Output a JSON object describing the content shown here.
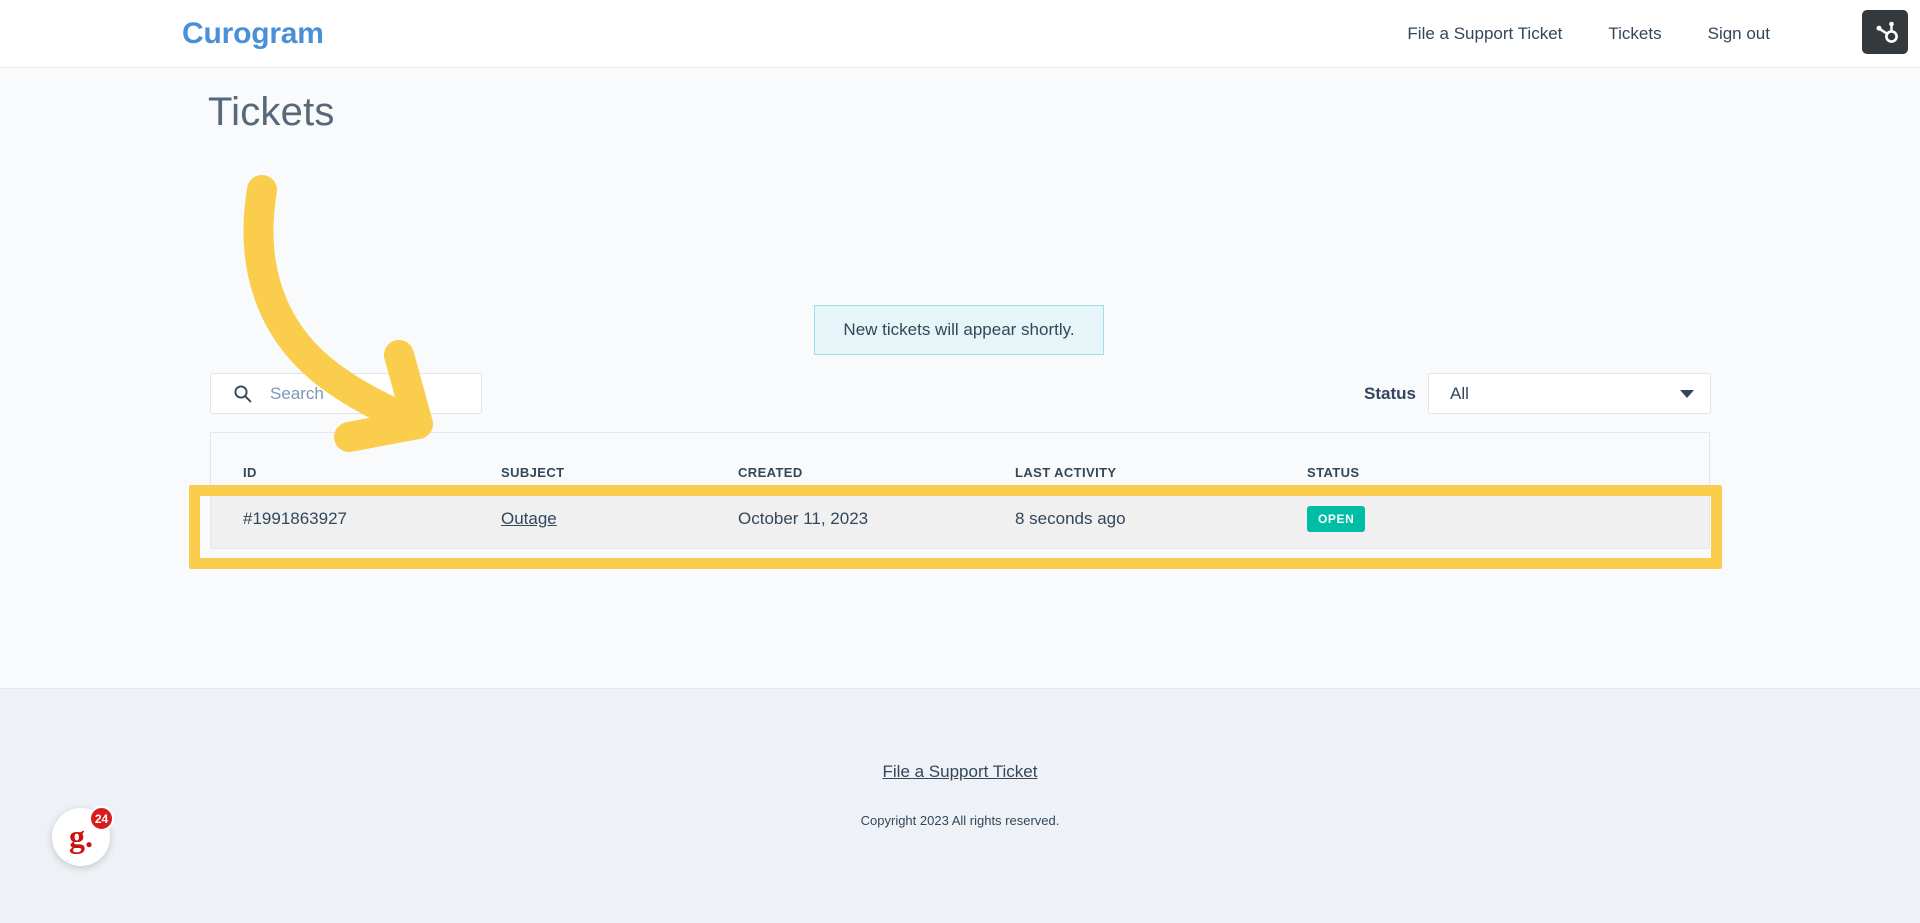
{
  "header": {
    "brand": "Curogram",
    "nav": [
      {
        "label": "File a Support Ticket",
        "name": "nav-file-ticket"
      },
      {
        "label": "Tickets",
        "name": "nav-tickets"
      },
      {
        "label": "Sign out",
        "name": "nav-sign-out"
      }
    ],
    "hubspot_icon": "hubspot-sprocket-icon",
    "assistant_icon": "assistant-brain-icon"
  },
  "main": {
    "page_title": "Tickets",
    "notice": "New tickets will appear shortly.",
    "search": {
      "placeholder": "Search",
      "value": "",
      "icon": "search-icon"
    },
    "status_filter": {
      "label": "Status",
      "selected": "All",
      "caret_icon": "chevron-down-icon"
    },
    "table": {
      "columns": [
        "ID",
        "SUBJECT",
        "CREATED",
        "LAST ACTIVITY",
        "STATUS"
      ],
      "rows": [
        {
          "id": "#1991863927",
          "subject": "Outage",
          "created": "October 11, 2023",
          "last_activity": "8 seconds ago",
          "status": "OPEN"
        }
      ]
    }
  },
  "footer": {
    "link": "File a Support Ticket",
    "copyright": "Copyright 2023 All rights reserved."
  },
  "chat_widget": {
    "logo": "g.",
    "badge_count": "24"
  },
  "colors": {
    "brand_blue": "#4a90d9",
    "notice_bg": "#e5f5f8",
    "notice_border": "#a1dce8",
    "status_open": "#00bda5",
    "annotation_yellow": "#fbcd4d",
    "page_bg": "#f8fafc",
    "footer_bg": "#eef2f6",
    "text": "#33475b"
  }
}
